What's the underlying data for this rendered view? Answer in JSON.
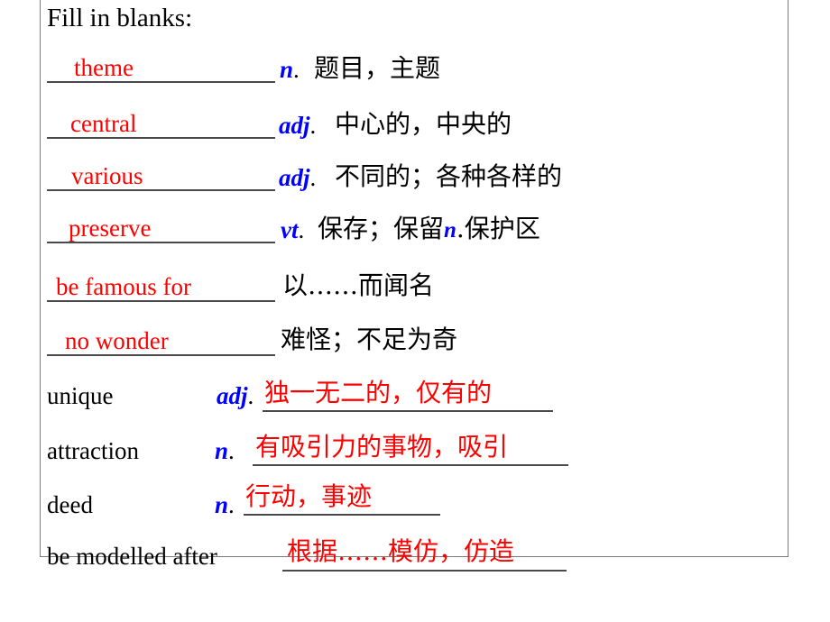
{
  "slide": {
    "title": "Fill in blanks:",
    "colors": {
      "answer_red": "#ff0000",
      "pos_blue": "#0000ff",
      "text_black": "#000000",
      "rule_gray": "#4a4a4a",
      "box_border": "#7a7a7a",
      "background": "#ffffff"
    }
  },
  "blanks_first": [
    {
      "answer": "theme",
      "pos": "n",
      "gloss": "题目，主题"
    },
    {
      "answer": "central",
      "pos": "adj",
      "gloss": "中心的，中央的"
    },
    {
      "answer": "various",
      "pos": "adj",
      "gloss": "不同的；各种各样的"
    },
    {
      "answer": "preserve",
      "pos": "vt",
      "gloss_part1": "保存；保留",
      "pos2": "n",
      "gloss_part2": "保护区"
    },
    {
      "answer": "be famous for",
      "pos": "",
      "gloss": "以……而闻名"
    },
    {
      "answer": "no wonder",
      "pos": "",
      "gloss": "难怪；不足为奇"
    }
  ],
  "blanks_second": [
    {
      "word": "unique",
      "pos": "adj",
      "answer": "独一无二的，仅有的"
    },
    {
      "word": "attraction",
      "pos": "n",
      "answer": "有吸引力的事物，吸引"
    },
    {
      "word": "deed",
      "pos": "n",
      "answer": "行动，事迹"
    },
    {
      "word": "be modelled after",
      "pos": "",
      "answer": "根据……模仿，仿造"
    }
  ]
}
